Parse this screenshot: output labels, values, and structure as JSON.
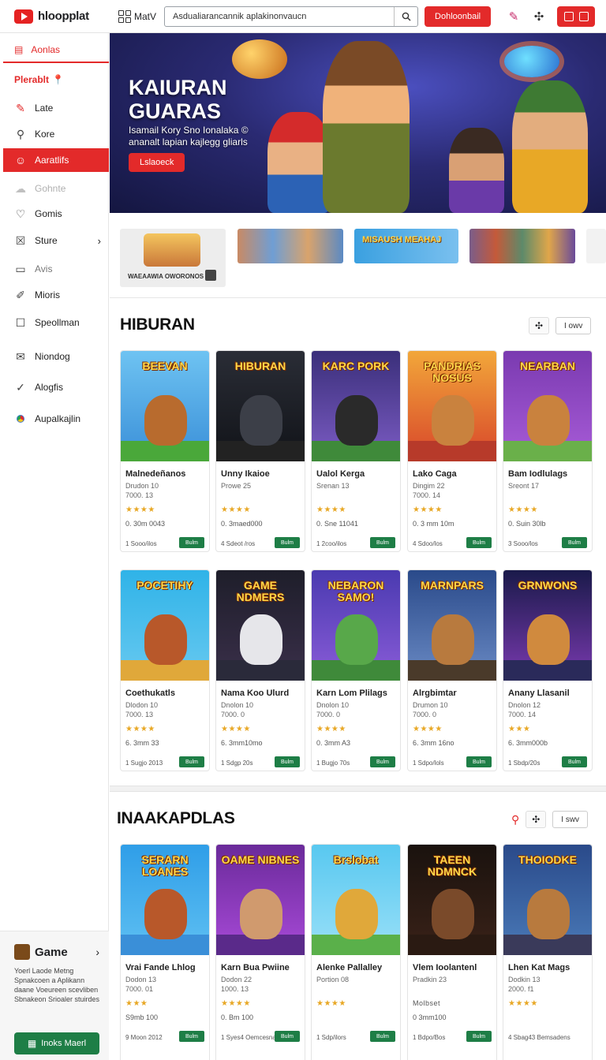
{
  "topbar": {
    "logo": "hloopplat",
    "menu_label": "MatV",
    "search_value": "Asdualiarancannik aplakinonvaucn",
    "cta_label": "Dohloonbail"
  },
  "sidebar": {
    "top_label": "Aonlas",
    "section_label": "Plerablt",
    "items": [
      {
        "label": "Late",
        "icon": "pen-icon"
      },
      {
        "label": "Kore",
        "icon": "search-icon"
      },
      {
        "label": "Aaratlifs",
        "icon": "user-icon"
      },
      {
        "label": "Gohnte",
        "icon": "cloud-icon"
      },
      {
        "label": "Gomis",
        "icon": "heart-icon"
      },
      {
        "label": "Sture",
        "icon": "store-icon"
      },
      {
        "label": "Avis",
        "icon": "doc-icon"
      },
      {
        "label": "Mioris",
        "icon": "pencil-icon"
      },
      {
        "label": "Speollman",
        "icon": "square-icon"
      },
      {
        "label": "Niondog",
        "icon": "mail-icon"
      },
      {
        "label": "Alogfis",
        "icon": "check-icon"
      },
      {
        "label": "Aupalkajlin",
        "icon": "chrome-icon"
      }
    ],
    "footer": {
      "title": "Game",
      "desc": "Yoerl Laode Metng Spnakcoen a Aplikann daane Voeureen scevliben Sbnakeon Srioaler stuirdes",
      "button": "Inoks Maerl"
    }
  },
  "hero": {
    "title": "KAIURAN GUARAS",
    "subtitle": "Isamail Kory Sno Ionalaka © ananalt lapian kajlegg gliarls",
    "button": "Lslaoeck"
  },
  "promo": {
    "card1_label": "WAEAAWIA OWORONOS",
    "card3_label": "MISAUSH MEAHAJ"
  },
  "section1": {
    "title": "HIBURAN",
    "see_all": "I owv",
    "row1": [
      {
        "art": "BEEVAN",
        "name": "Malnedeñanos",
        "meta1": "Drudon 10",
        "meta2": "7000.   13",
        "stars": "★★★★",
        "count": "0. 30m 0043",
        "foot": "1 Sooo/ilos",
        "dl": "Bulm"
      },
      {
        "art": "HIBURAN",
        "name": "Unny Ikaioe",
        "meta1": "Prowe 25",
        "meta2": "",
        "stars": "★★★★",
        "count": "0. 3maed000",
        "foot": "4 Sdeot /ros",
        "dl": "Bulm"
      },
      {
        "art": "KARC PORK",
        "name": "Ualol Kerga",
        "meta1": "Srenan 13",
        "meta2": "",
        "stars": "★★★★",
        "count": "0. Sne 11041",
        "foot": "1 2coo/ilos",
        "dl": "Bulm"
      },
      {
        "art": "PANDRIAS NOSUS",
        "name": "Lako Caga",
        "meta1": "Dingim 22",
        "meta2": "7000.   14",
        "stars": "★★★★",
        "count": "0. 3 mm 10m",
        "foot": "4 Sdoo/los",
        "dl": "Bulm"
      },
      {
        "art": "NEARBAN",
        "name": "Bam Iodlulags",
        "meta1": "Sreont 17",
        "meta2": "",
        "stars": "★★★★",
        "count": "0. Suin 30lb",
        "foot": "3 Sooo/los",
        "dl": "Bulm"
      }
    ],
    "row2": [
      {
        "art": "POCETIHY",
        "name": "Coethukatls",
        "meta1": "Dlodon 10",
        "meta2": "7000.   13",
        "stars": "★★★★",
        "count": "6. 3mm 33",
        "foot": "1 Sugjo 2013",
        "dl": "Bulm"
      },
      {
        "art": "GAME NDMERS",
        "name": "Nama Koo Ulurd",
        "meta1": "Dnolon 10",
        "meta2": "7000.   0",
        "stars": "★★★★",
        "count": "6. 3mm10mo",
        "foot": "1 Sdgp 20s",
        "dl": "Bulm"
      },
      {
        "art": "NEBARON SAMO!",
        "name": "Karn Lom Plilags",
        "meta1": "Dnolon 10",
        "meta2": "7000.   0",
        "stars": "★★★★",
        "count": "0. 3mm A3",
        "foot": "1 Bugjo 70s",
        "dl": "Bulm"
      },
      {
        "art": "MARNPARS",
        "name": "Alrgbimtar",
        "meta1": "Drumon 10",
        "meta2": "7000.   0",
        "stars": "★★★★",
        "count": "6. 3mm 16no",
        "foot": "1 Sdpo/lols",
        "dl": "Bulm"
      },
      {
        "art": "GRNWONS",
        "name": "Anany Llasanil",
        "meta1": "Dnolon 12",
        "meta2": "7000.   14",
        "stars": "★★★",
        "count": "6. 3mm000b",
        "foot": "1 Sbdp/20s",
        "dl": "Bulm"
      }
    ]
  },
  "section2": {
    "title": "INAAKAPDLAS",
    "see_all": "I swv",
    "row": [
      {
        "art": "SERARN LOANES",
        "name": "Vrai Fande Lhlog",
        "meta1": "Dodon 13",
        "meta2": "7000.   01",
        "stars": "★★★",
        "count": "S9mb 100",
        "foot": "9 Moon 2012",
        "dl": "Bulm"
      },
      {
        "art": "OAME NIBNES",
        "name": "Karn Bua Pwiine",
        "meta1": "Dodon 22",
        "meta2": "1000.   13",
        "stars": "★★★★",
        "count": "0. Bm 100",
        "foot": "1 Syes4 Oemcesna",
        "dl": "Bulm"
      },
      {
        "art": "Brslobat",
        "name": "Alenke Pallalley",
        "meta1": "Portion 08",
        "meta2": "",
        "stars": "★★★★",
        "count": "",
        "foot": "1 Sdp/ilors",
        "dl": "Bulm"
      },
      {
        "art": "TAEEN NDMNCK",
        "name": "Vlem Ioolantenl",
        "meta1": "Pradkin 23",
        "meta2": "",
        "stars": "Molbset",
        "count": "0 3mm100",
        "foot": "1 Bdpo/Bos",
        "dl": "Bulm"
      },
      {
        "art": "THOIODKE",
        "name": "Lhen Kat Mags",
        "meta1": "Dodkin 13",
        "meta2": "2000.   f1",
        "stars": "★★★★",
        "count": "",
        "foot": "4 Sbag43 Bemsadens",
        "dl": ""
      }
    ]
  },
  "colors": {
    "accent": "#e32a2a",
    "download_green": "#1e7e46",
    "star": "#e8a826"
  }
}
